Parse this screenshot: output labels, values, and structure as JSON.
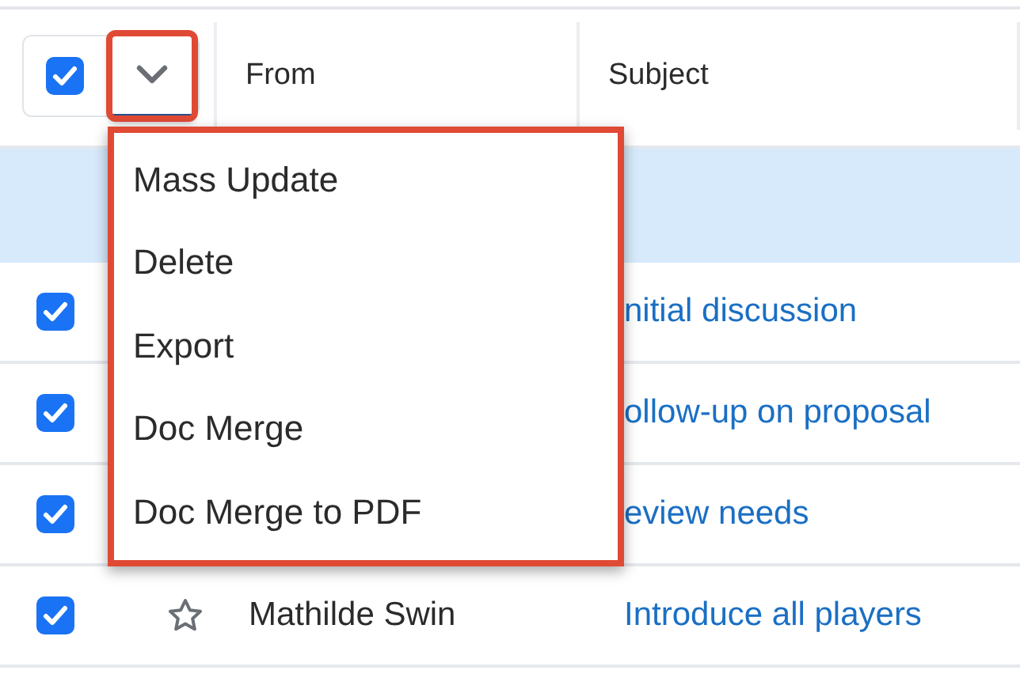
{
  "header": {
    "select_all": {
      "checked": true
    },
    "actions_button": {
      "highlighted": true
    },
    "columns": [
      "From",
      "Subject"
    ]
  },
  "actions_menu": {
    "highlighted": true,
    "items": [
      "Mass Update",
      "Delete",
      "Export",
      "Doc Merge",
      "Doc Merge to PDF"
    ]
  },
  "rows": [
    {
      "checked": true,
      "subject": "nitial discussion"
    },
    {
      "checked": true,
      "subject": "ollow-up on proposal"
    },
    {
      "checked": true,
      "subject": "eview needs"
    },
    {
      "checked": true,
      "starred": false,
      "from": "Mathilde Swin",
      "subject": "Introduce all players"
    }
  ]
}
